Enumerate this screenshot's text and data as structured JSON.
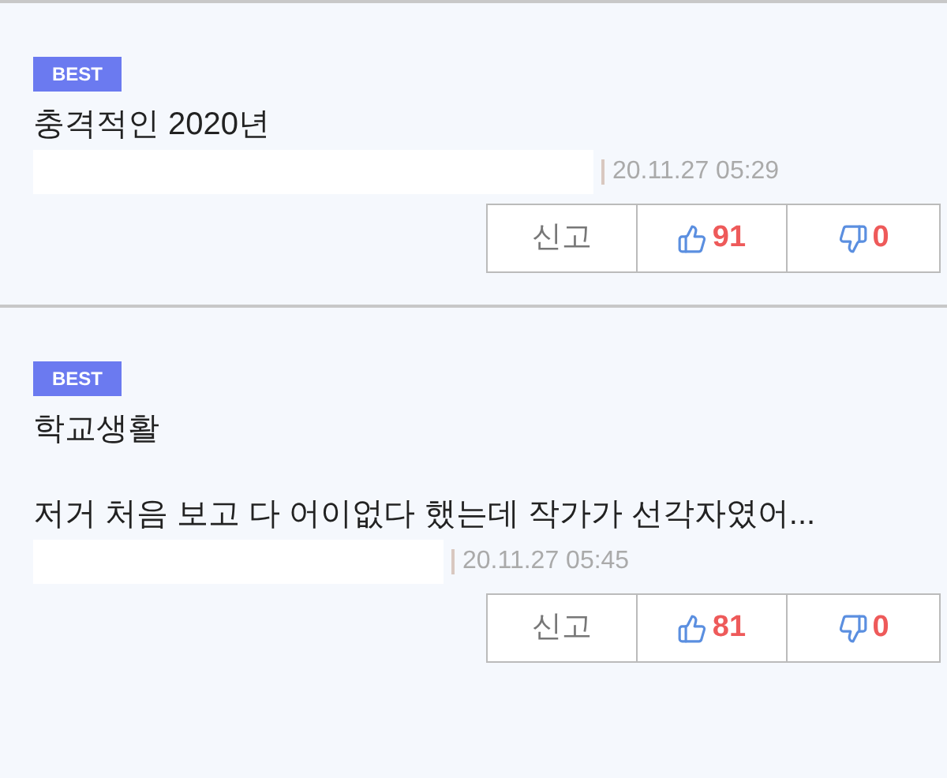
{
  "comments": [
    {
      "badge": "BEST",
      "paragraphs": [
        "충격적인 2020년"
      ],
      "timestamp": "20.11.27 05:29",
      "report": "신고",
      "likes": "91",
      "dislikes": "0"
    },
    {
      "badge": "BEST",
      "paragraphs": [
        "학교생활",
        "저거 처음 보고 다 어이없다 했는데 작가가 선각자였어..."
      ],
      "timestamp": "20.11.27 05:45",
      "report": "신고",
      "likes": "81",
      "dislikes": "0"
    }
  ]
}
